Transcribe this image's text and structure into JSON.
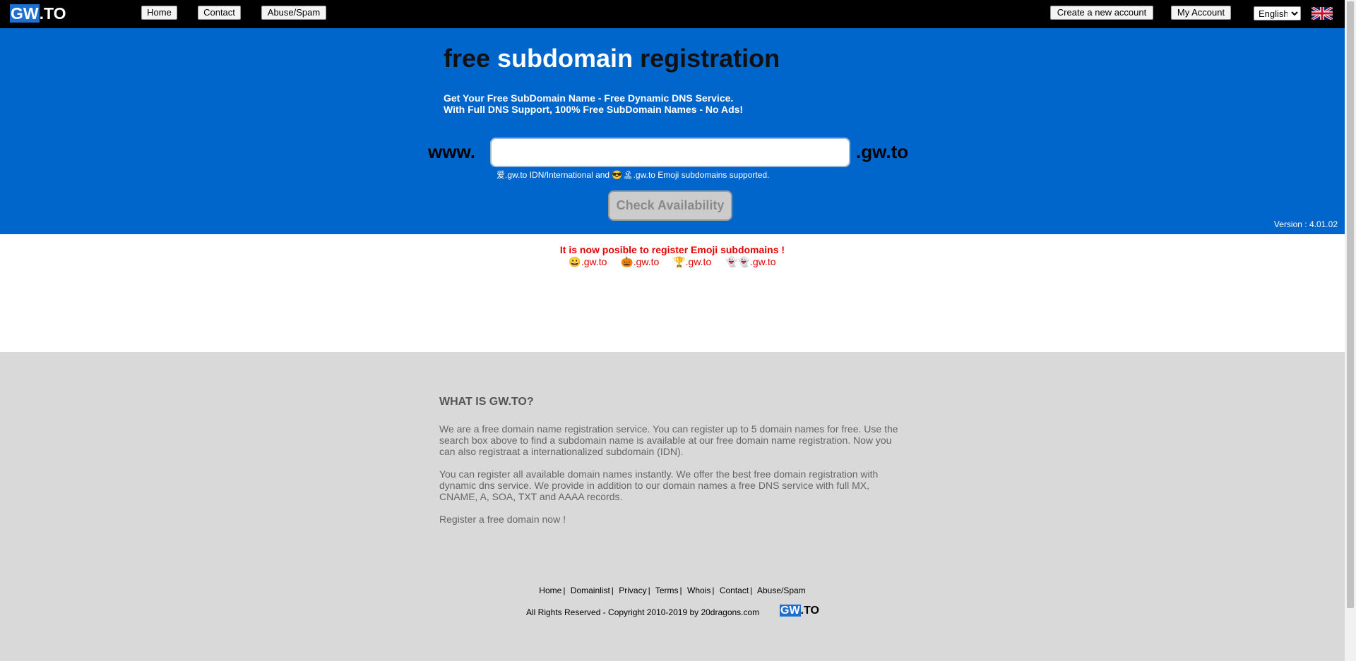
{
  "header": {
    "logo_gw": "GW",
    "logo_to": ".TO",
    "nav": {
      "home": "Home",
      "contact": "Contact",
      "abuse": "Abuse/Spam"
    },
    "create_account": "Create a new account",
    "my_account": "My Account",
    "language": "English",
    "flag_icon": "uk-flag-icon"
  },
  "hero": {
    "title_part1": "free ",
    "title_part2": "subdomain",
    "title_part3": " registration",
    "subtitle_line1": "Get Your Free SubDomain Name - Free Dynamic DNS Service.",
    "subtitle_line2": "With Full DNS Support, 100% Free SubDomain Names - No Ads!",
    "www_prefix": "www.",
    "input_value": "",
    "suffix": ".gw.to",
    "idn_note": "爱.gw.to IDN/International and 😎🏝.gw.to Emoji subdomains supported.",
    "check_button": "Check Availability",
    "version": "Version : 4.01.02"
  },
  "emoji_section": {
    "notice": "It is now posible to register Emoji subdomains !",
    "links": [
      "😀.gw.to",
      "🎃.gw.to",
      "🏆.gw.to",
      "👻👻.gw.to"
    ]
  },
  "about": {
    "title": "WHAT IS GW.TO?",
    "para1": "We are a free domain name registration service. You can register up to 5 domain names for free. Use the search box above to find a subdomain name is available at our free domain name registration. Now you can also registraat a internationalized subdomain (IDN).",
    "para2": "You can register all available domain names instantly. We offer the best free domain registration with dynamic dns service. We provide in addition to our domain names a free DNS service with full MX, CNAME, A, SOA, TXT and AAAA records.",
    "para3": "Register a free domain now !"
  },
  "footer": {
    "links": [
      "Home",
      "Domainlist",
      "Privacy",
      "Terms",
      "Whois",
      "Contact",
      "Abuse/Spam"
    ],
    "copyright": "All Rights Reserved - Copyright 2010-2019 by 20dragons.com",
    "logo_gw": "GW",
    "logo_to": ".TO"
  }
}
